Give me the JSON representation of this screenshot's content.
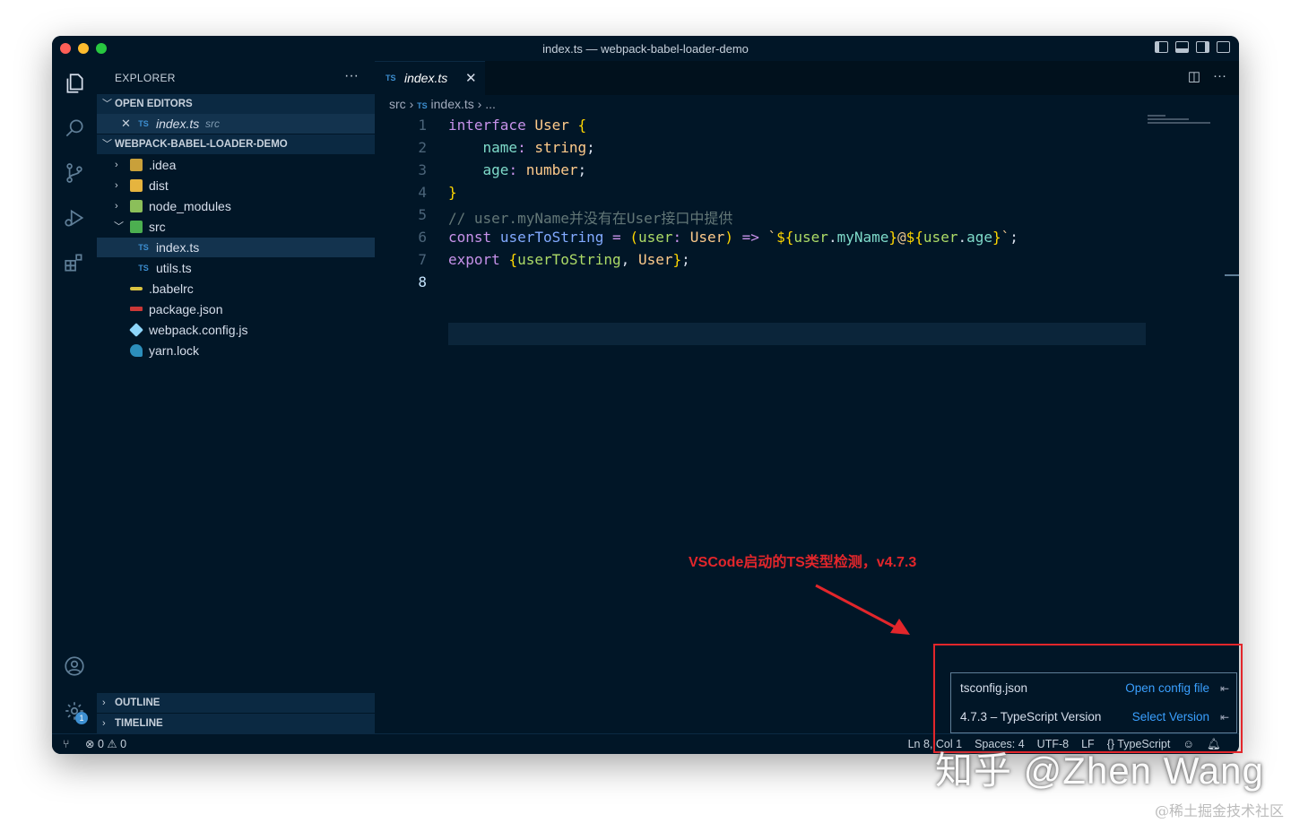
{
  "window": {
    "title": "index.ts — webpack-babel-loader-demo"
  },
  "sidebar": {
    "header": "EXPLORER",
    "more": "···",
    "open_editors": {
      "label": "OPEN EDITORS",
      "item_name": "index.ts",
      "item_path": "src",
      "close": "✕",
      "icon_text": "TS"
    },
    "project": {
      "label": "WEBPACK-BABEL-LOADER-DEMO",
      "items": [
        {
          "label": ".idea",
          "icon": "folder-icon"
        },
        {
          "label": "dist",
          "icon": "folder-icon"
        },
        {
          "label": "node_modules",
          "icon": "folder-icon"
        },
        {
          "label": "src",
          "icon": "folder-open-icon"
        },
        {
          "label": "index.ts",
          "icon": "typescript-icon",
          "icon_text": "TS"
        },
        {
          "label": "utils.ts",
          "icon": "typescript-icon",
          "icon_text": "TS"
        },
        {
          "label": ".babelrc",
          "icon": "babel-icon"
        },
        {
          "label": "package.json",
          "icon": "npm-icon"
        },
        {
          "label": "webpack.config.js",
          "icon": "webpack-icon"
        },
        {
          "label": "yarn.lock",
          "icon": "yarn-icon"
        }
      ]
    },
    "outline": "OUTLINE",
    "timeline": "TIMELINE"
  },
  "editor": {
    "tab": {
      "label": "index.ts",
      "icon_text": "TS",
      "close": "✕"
    },
    "breadcrumb": {
      "folder": "src",
      "file": "index.ts",
      "icon_text": "TS",
      "rest": "..."
    },
    "line_numbers": [
      "1",
      "2",
      "3",
      "4",
      "5",
      "6",
      "7",
      "8"
    ],
    "code": {
      "l1": {
        "kw": "interface",
        "name": "User",
        "brace": "{"
      },
      "l2": {
        "prop": "name",
        "colon": ":",
        "type": "string",
        "semi": ";"
      },
      "l3": {
        "prop": "age",
        "colon": ":",
        "type": "number",
        "semi": ";"
      },
      "l4": {
        "brace": "}"
      },
      "l5": {
        "comment": "// user.myName并没有在User接口中提供"
      },
      "l6": {
        "kw": "const",
        "name": "userToString",
        "eq": "=",
        "lp": "(",
        "param": "user",
        "colon": ":",
        "type": "User",
        "rp": ")",
        "arrow": "=>",
        "tpl_start": "`",
        "d1": "${",
        "obj1": "user",
        "dot1": ".",
        "prop1": "myName",
        "c1": "}",
        "at": "@",
        "d2": "${",
        "obj2": "user",
        "dot2": ".",
        "prop2": "age",
        "c2": "}",
        "tpl_end": "`",
        "semi": ";"
      },
      "l7": {
        "kw": "export",
        "lb": "{",
        "n1": "userToString",
        "comma": ",",
        "n2": "User",
        "rb": "}",
        "semi": ";"
      }
    }
  },
  "statusbar": {
    "errors": "0",
    "warnings": "0",
    "position": "Ln 8, Col 1",
    "spaces": "Spaces: 4",
    "encoding": "UTF-8",
    "eol": "LF",
    "language_braces": "{}",
    "language": "TypeScript"
  },
  "popup": {
    "row1": {
      "label": "tsconfig.json",
      "link": "Open config file"
    },
    "row2": {
      "label": "4.7.3 – TypeScript Version",
      "link": "Select Version"
    }
  },
  "annotation": {
    "text": "VSCode启动的TS类型检测，v4.7.3",
    "color": "#e3262b"
  },
  "watermark": {
    "text": "知乎 @Zhen Wang",
    "credit": "@稀土掘金技术社区"
  },
  "colors": {
    "background": "#011627",
    "accent": "#3aa0ff",
    "annotation": "#e3262b"
  }
}
